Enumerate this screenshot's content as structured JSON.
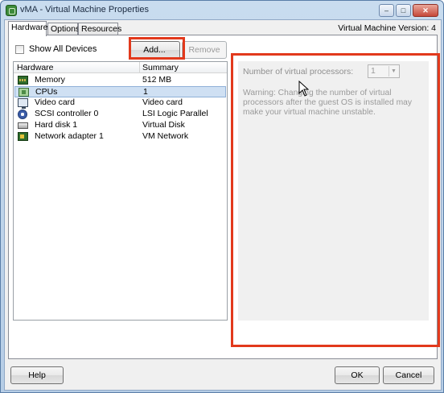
{
  "window": {
    "title": "vMA - Virtual Machine Properties",
    "minimize_glyph": "–",
    "maximize_glyph": "□",
    "close_glyph": "✕"
  },
  "tabs": [
    {
      "label": "Hardware",
      "active": true
    },
    {
      "label": "Options",
      "active": false
    },
    {
      "label": "Resources",
      "active": false
    }
  ],
  "vm_version": "Virtual Machine Version: 4",
  "hardware_panel": {
    "show_all_devices": {
      "label": "Show All Devices",
      "checked": false
    },
    "add_button": "Add...",
    "remove_button": "Remove",
    "columns": [
      "Hardware",
      "Summary"
    ],
    "rows": [
      {
        "icon": "memory-icon",
        "name": "Memory",
        "summary": "512 MB",
        "selected": false
      },
      {
        "icon": "cpu-icon",
        "name": "CPUs",
        "summary": "1",
        "selected": true
      },
      {
        "icon": "video-card-icon",
        "name": "Video card",
        "summary": "Video card",
        "selected": false
      },
      {
        "icon": "scsi-controller-icon",
        "name": "SCSI controller 0",
        "summary": "LSI Logic Parallel",
        "selected": false
      },
      {
        "icon": "hard-disk-icon",
        "name": "Hard disk 1",
        "summary": "Virtual Disk",
        "selected": false
      },
      {
        "icon": "network-adapter-icon",
        "name": "Network adapter 1",
        "summary": "VM Network",
        "selected": false
      }
    ]
  },
  "cpu_settings": {
    "label": "Number of virtual processors:",
    "value": "1",
    "warning": "Warning: Changing the number of virtual processors after the guest OS is installed may make your virtual machine unstable."
  },
  "footer": {
    "help_button": "Help",
    "ok_button": "OK",
    "cancel_button": "Cancel"
  },
  "colors": {
    "highlight_box": "#e2391c",
    "selected_row": "#cfe0f3"
  }
}
